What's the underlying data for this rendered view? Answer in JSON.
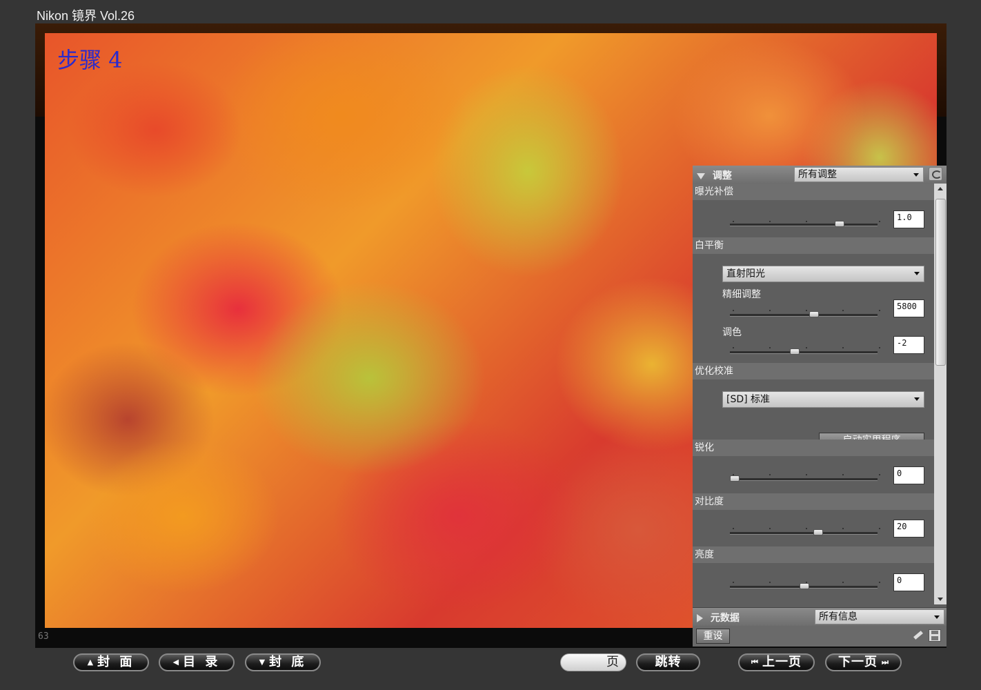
{
  "app": {
    "title": "Nikon 镜界 Vol.26"
  },
  "viewer": {
    "step_label": "步骤 4",
    "page_number": "63"
  },
  "panel": {
    "header_label": "调整",
    "header_dropdown": "所有调整",
    "exposure": {
      "title": "曝光补偿",
      "value": "1.0",
      "level": 0.75
    },
    "white_balance": {
      "title": "白平衡",
      "preset": "直射阳光",
      "fine_label": "精细调整",
      "fine_value": "5800",
      "fine_level": 0.57,
      "tint_label": "调色",
      "tint_value": "-2",
      "tint_level": 0.43
    },
    "picture_control": {
      "title": "优化校准",
      "preset": "[SD] 标准",
      "utility_button": "启动实用程序"
    },
    "sharpening": {
      "title": "锐化",
      "value": "0",
      "level": 0.0
    },
    "contrast": {
      "title": "对比度",
      "value": "20",
      "level": 0.6
    },
    "brightness": {
      "title": "亮度",
      "value": "0",
      "level": 0.5
    },
    "metadata": {
      "label": "元数据",
      "dropdown": "所有信息"
    },
    "reset_label": "重设"
  },
  "nav": {
    "cover": "封 面",
    "contents": "目 录",
    "back_cover": "封 底",
    "page_suffix": "页",
    "jump": "跳转",
    "prev": "上一页",
    "next": "下一页"
  },
  "icons": {
    "cover_arrow": "up-triangle-icon",
    "contents_arrow": "left-triangle-icon",
    "back_cover_arrow": "down-triangle-icon",
    "prev_icon": "skip-back-icon",
    "next_icon": "skip-forward-icon"
  }
}
